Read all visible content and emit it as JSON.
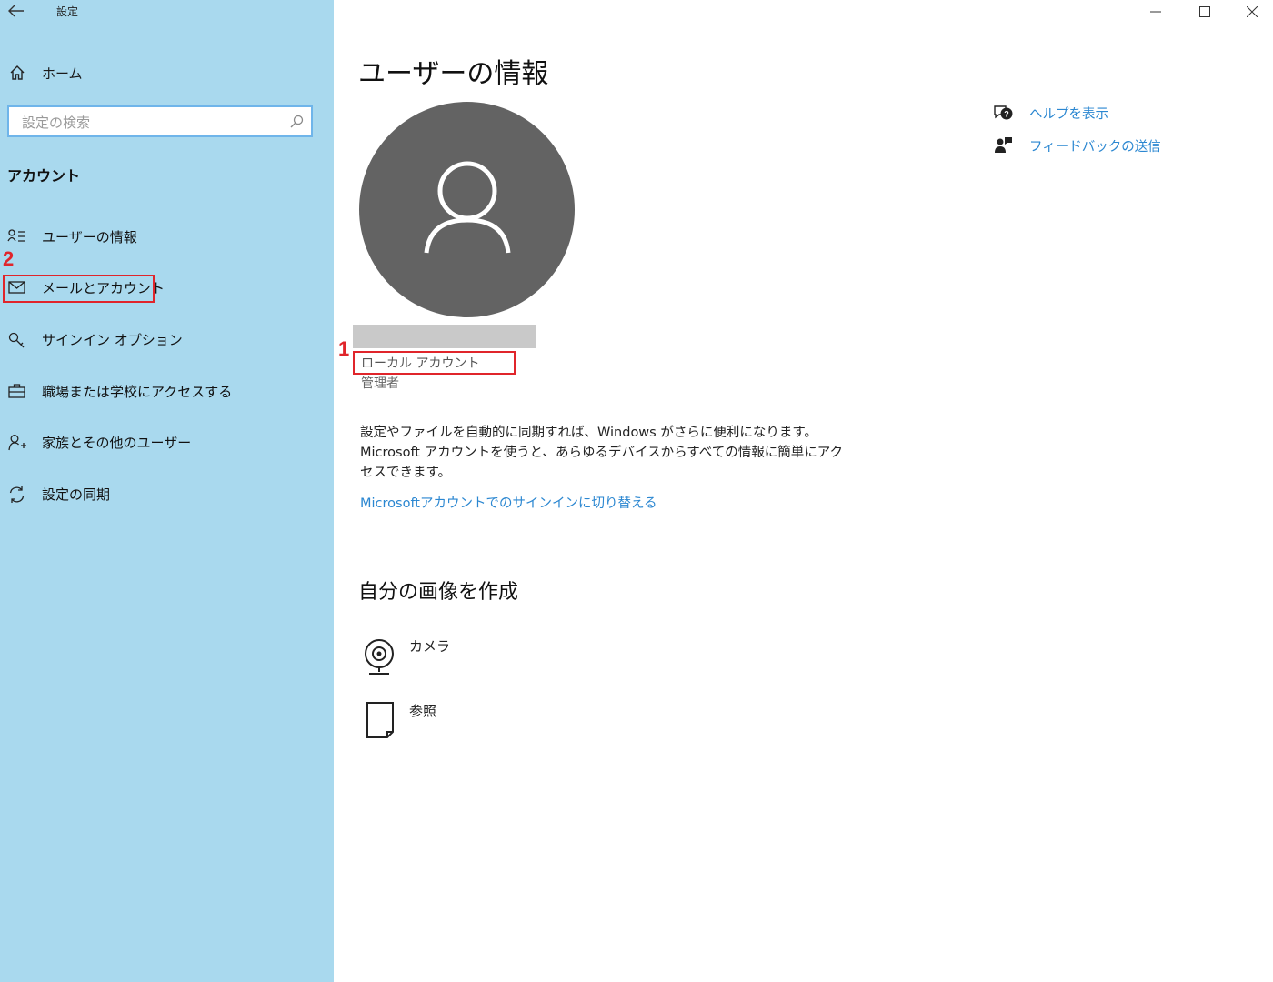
{
  "window": {
    "title": "設定",
    "controls": [
      "minimize",
      "maximize",
      "close"
    ]
  },
  "sidebar": {
    "home_label": "ホーム",
    "search_placeholder": "設定の検索",
    "section_label": "アカウント",
    "items": [
      {
        "label": "ユーザーの情報",
        "icon": "person-list-icon"
      },
      {
        "label": "メールとアカウント",
        "icon": "mail-icon"
      },
      {
        "label": "サインイン オプション",
        "icon": "key-icon"
      },
      {
        "label": "職場または学校にアクセスする",
        "icon": "briefcase-icon"
      },
      {
        "label": "家族とその他のユーザー",
        "icon": "person-add-icon"
      },
      {
        "label": "設定の同期",
        "icon": "sync-icon"
      }
    ]
  },
  "main": {
    "title": "ユーザーの情報",
    "account_type": "ローカル アカウント",
    "account_role": "管理者",
    "description": "設定やファイルを自動的に同期すれば、Windows がさらに便利になります。Microsoft アカウントを使うと、あらゆるデバイスからすべての情報に簡単にアクセスできます。",
    "switch_link": "Microsoftアカウントでのサインインに切り替える",
    "create_picture_title": "自分の画像を作成",
    "picture_options": [
      {
        "label": "カメラ",
        "icon": "camera-icon"
      },
      {
        "label": "参照",
        "icon": "browse-file-icon"
      }
    ]
  },
  "help": {
    "show_help": "ヘルプを表示",
    "send_feedback": "フィードバックの送信"
  },
  "annotations": {
    "callout_1": "1",
    "callout_2": "2",
    "color": "#e0252b"
  },
  "colors": {
    "sidebar_bg": "#a9d9ee",
    "link": "#2b87d1",
    "avatar_bg": "#636363"
  }
}
